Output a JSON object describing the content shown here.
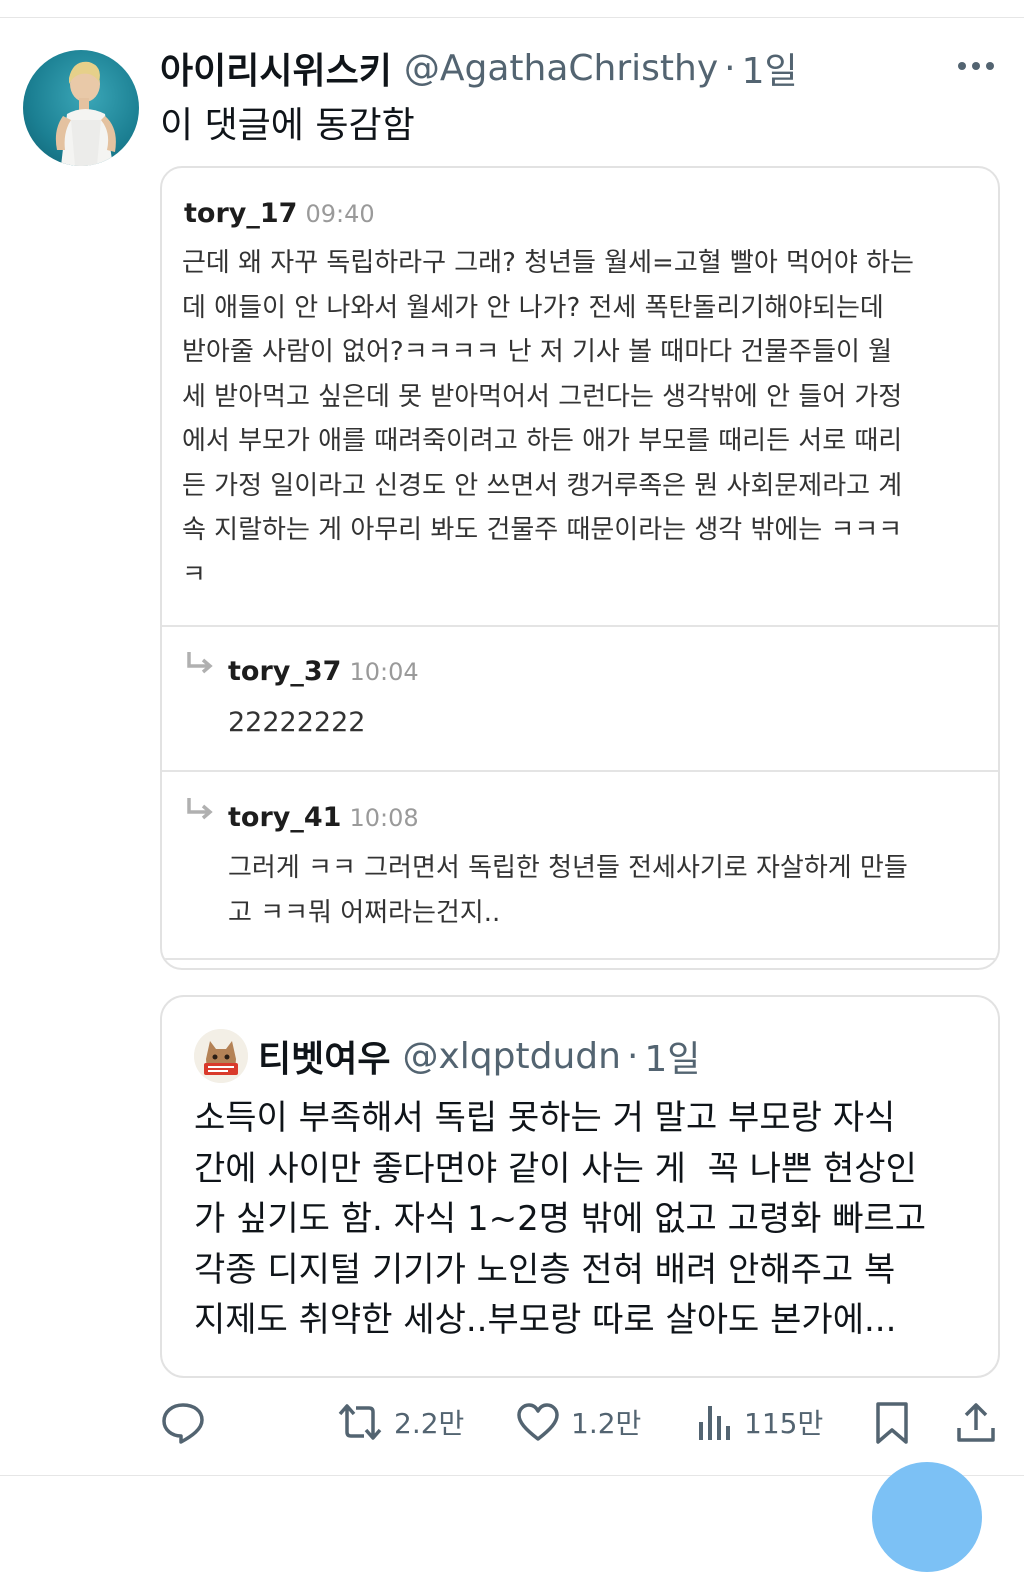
{
  "tweet": {
    "display_name": "아이리시위스키",
    "handle": "@AgathaChristhy",
    "separator": "·",
    "time": "1일",
    "text": "이 댓글에 동감함",
    "more_icon": "more-dots-icon"
  },
  "embedded_comments": {
    "main": {
      "user": "tory_17",
      "time": "09:40",
      "lines": [
        "근데 왜 자꾸 독립하라구 그래? 청년들 월세=고혈 빨아 먹어야 하는",
        "데 애들이 안 나와서 월세가 안 나가? 전세 폭탄돌리기해야되는데",
        "받아줄 사람이 없어?ㅋㅋㅋㅋ 난 저 기사 볼 때마다 건물주들이 월",
        "세 받아먹고 싶은데 못 받아먹어서 그런다는 생각밖에 안 들어 가정",
        "에서 부모가 애를 때려죽이려고 하든 애가 부모를 때리든 서로 때리",
        "든 가정 일이라고 신경도 안 쓰면서 캥거루족은 뭔 사회문제라고 계",
        "속 지랄하는 게 아무리 봐도 건물주 때문이라는 생각 밖에는 ㅋㅋㅋ",
        "ㅋ"
      ]
    },
    "replies": [
      {
        "user": "tory_37",
        "time": "10:04",
        "lines": [
          "22222222"
        ]
      },
      {
        "user": "tory_41",
        "time": "10:08",
        "lines": [
          "그러게 ㅋㅋ 그러면서 독립한 청년들 전세사기로 자살하게 만들",
          "고 ㅋㅋ뭐 어쩌라는건지.."
        ]
      }
    ]
  },
  "quote": {
    "display_name": "티벳여우",
    "handle": "@xlqptdudn",
    "separator": "·",
    "time": "1일",
    "lines": [
      "소득이 부족해서 독립 못하는 거 말고 부모랑 자식",
      "간에 사이만 좋다면야 같이 사는 게  꼭 나쁜 현상인",
      "가 싶기도 함. 자식 1~2명 밖에 없고 고령화 빠르고",
      "각종 디지털 기기가 노인층 전혀 배려 안해주고 복",
      "지제도 취약한 세상..부모랑 따로 살아도 본가에..."
    ]
  },
  "actions": {
    "reply_icon": "reply-icon",
    "retweet_count": "2.2만",
    "like_count": "1.2만",
    "views_count": "115만",
    "bookmark_icon": "bookmark-icon",
    "share_icon": "share-icon"
  },
  "colors": {
    "text_primary": "#0f1419",
    "text_secondary": "#536471",
    "border": "#e2e2e2",
    "fab": "#7cc1f5"
  }
}
